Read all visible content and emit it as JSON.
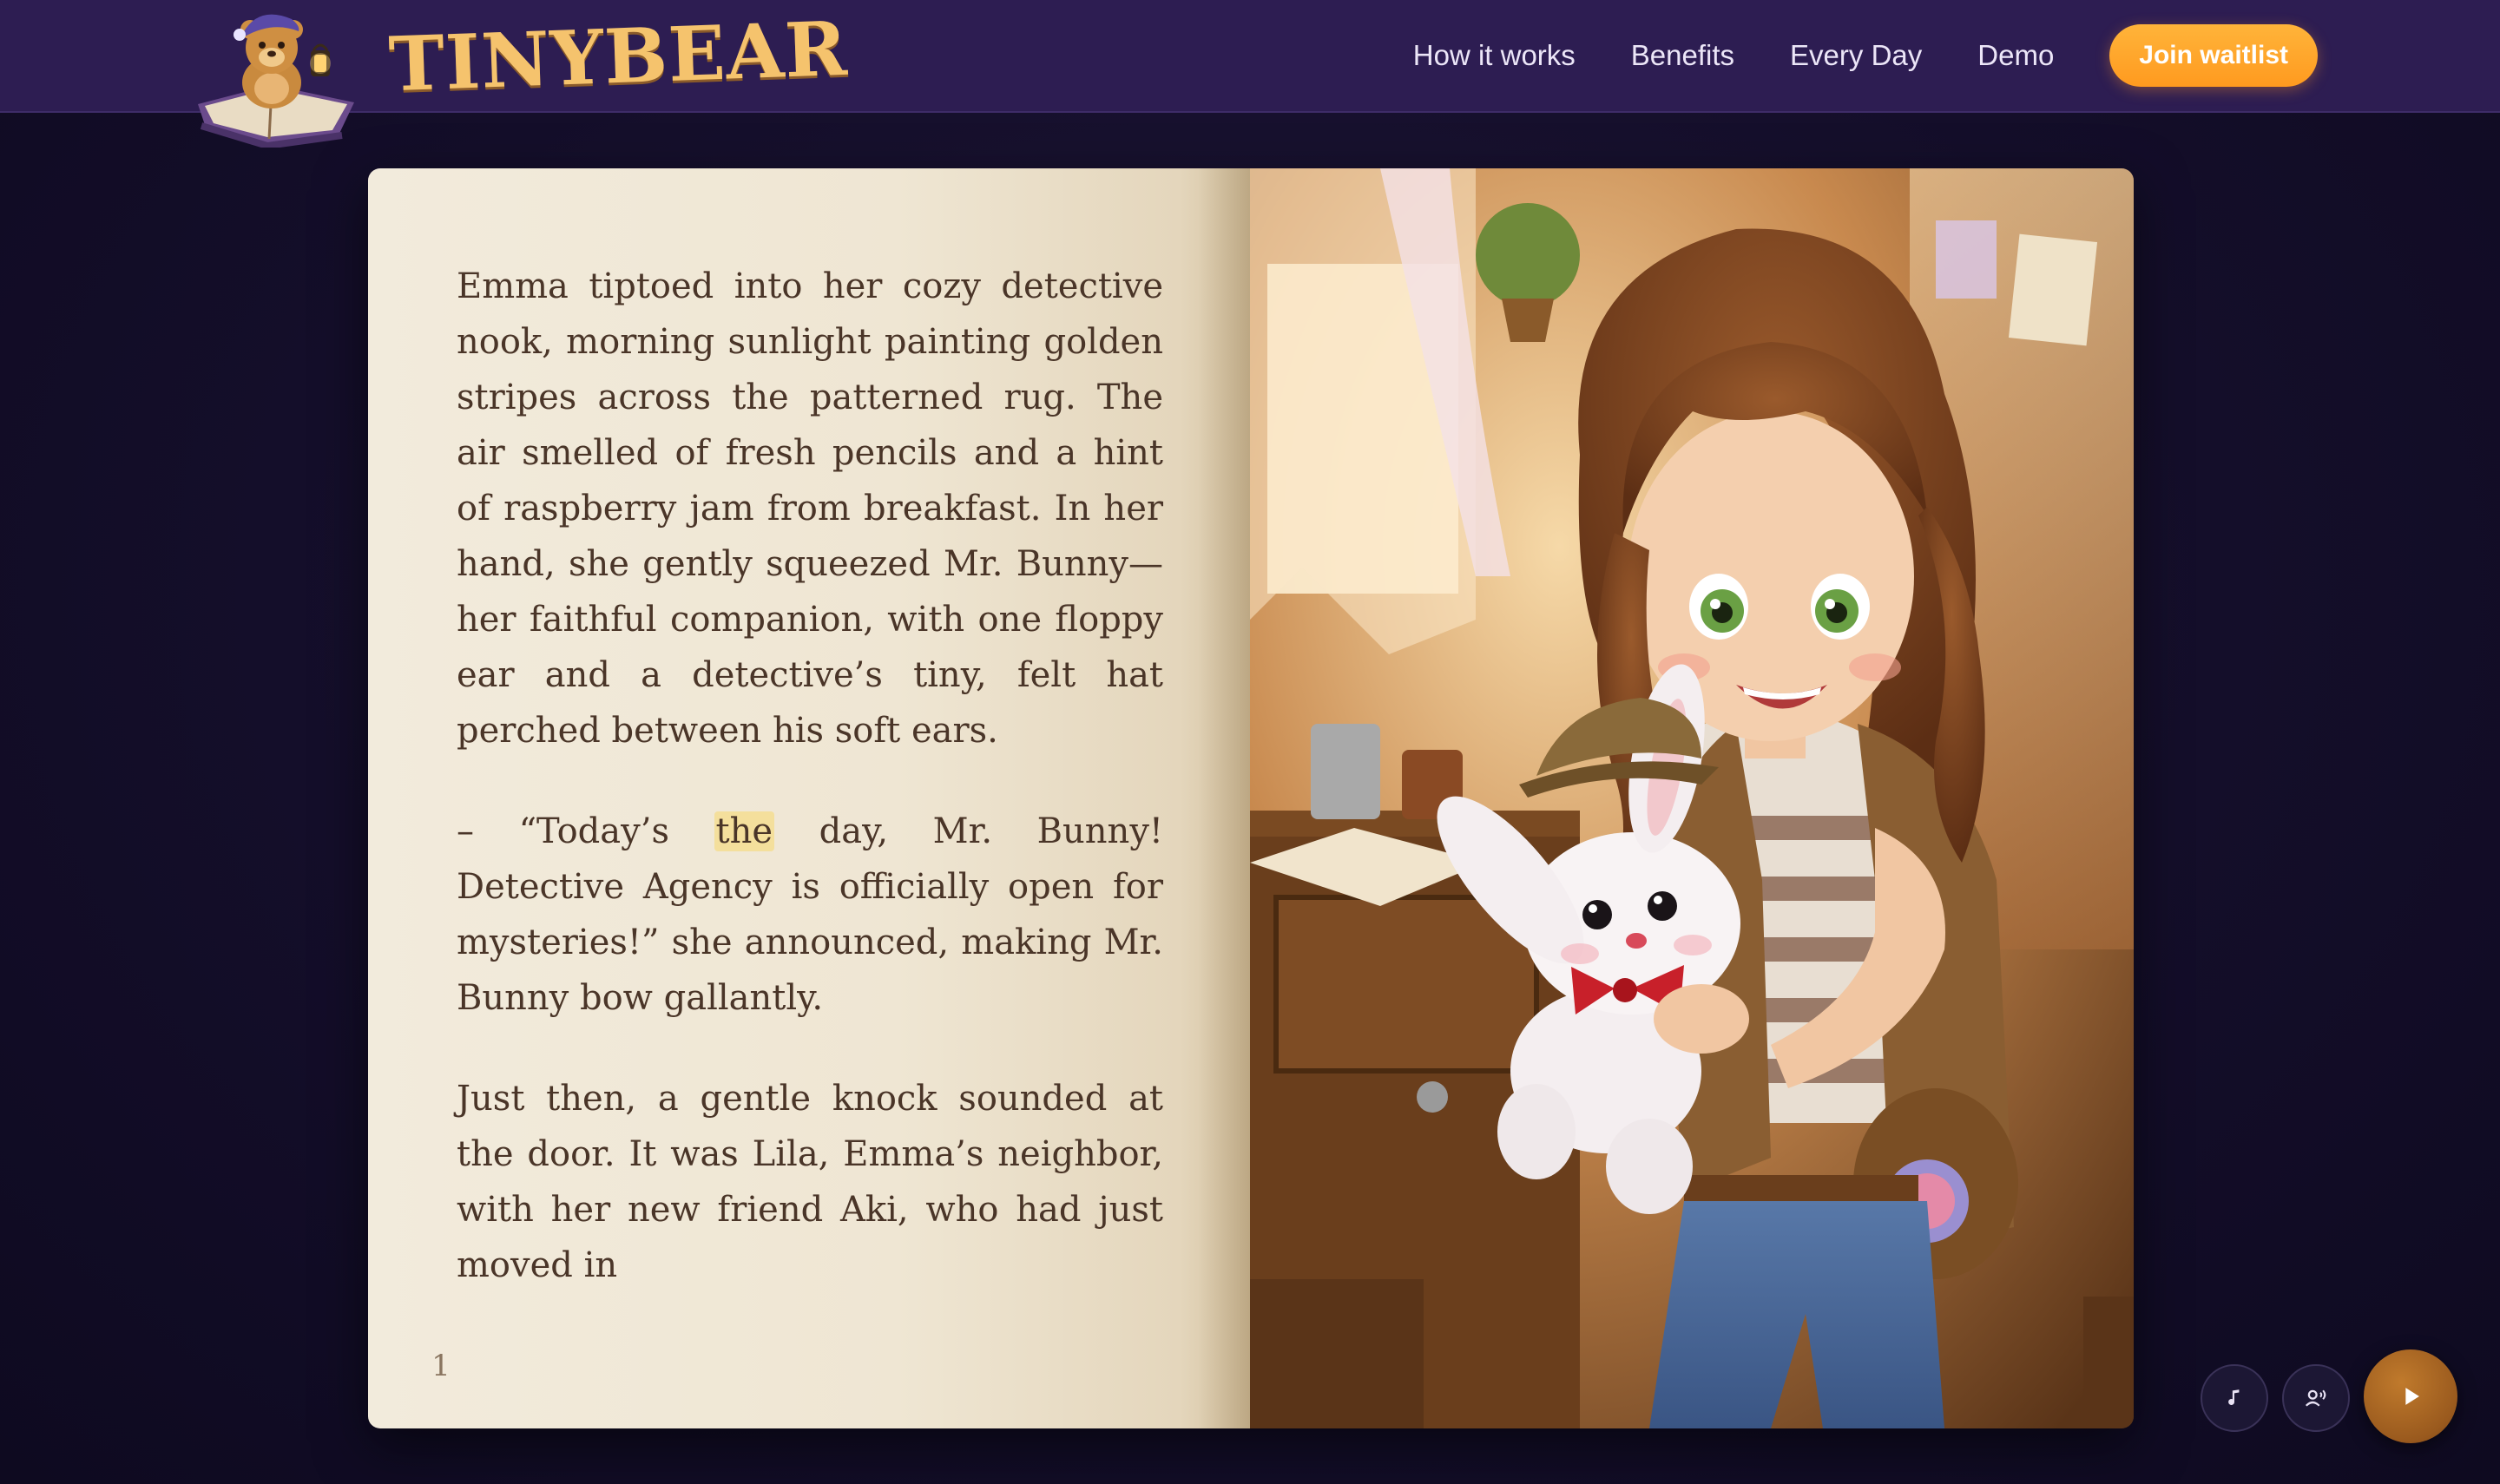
{
  "nav": {
    "brand": "TINYBEAR",
    "links": [
      "How it works",
      "Benefits",
      "Every Day",
      "Demo"
    ],
    "cta_label": "Join waitlist"
  },
  "story": {
    "paragraph_1": "Emma tiptoed into her cozy detective nook, morning sunlight painting golden stripes across the patterned rug. The air smelled of fresh pencils and a hint of raspberry jam from breakfast. In her hand, she gently squeezed Mr. Bunny—her faithful companion, with one floppy ear and a detective’s tiny, felt hat perched between his soft ears.",
    "paragraph_2_before": "– “Today’s ",
    "paragraph_2_highlight": "the",
    "paragraph_2_after": " day, Mr. Bunny! Detective Agency is officially open for mysteries!” she announced, making Mr. Bunny bow gallantly.",
    "paragraph_3": "Just then, a gentle knock sounded at the door. It was Lila, Emma’s neighbor, with her new friend Aki, who had just moved in",
    "page_number": "1"
  },
  "illustration": {
    "subject": "girl-with-bunny-illustration"
  },
  "controls": {
    "music_icon": "music-note-icon",
    "voice_icon": "voice-narrator-icon",
    "play_icon": "play-icon"
  },
  "colors": {
    "nav_bg": "#2d1d52",
    "page_bg": "#150f2c",
    "brand": "#f5c36d",
    "cta": "#ffa52a",
    "highlight": "#f4df9c",
    "text": "#4a3528"
  }
}
